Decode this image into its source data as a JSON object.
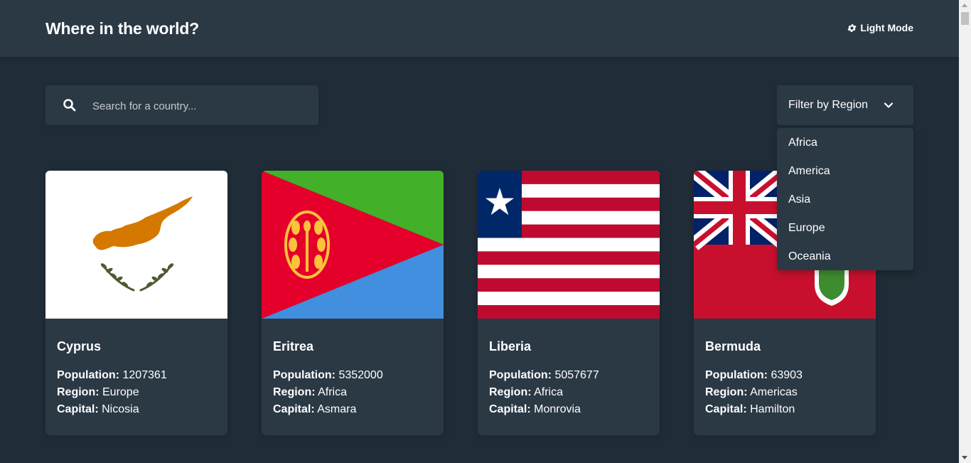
{
  "header": {
    "title": "Where in the world?",
    "mode_toggle_label": "Light Mode",
    "mode_toggle_icon": "gear-icon"
  },
  "search": {
    "placeholder": "Search for a country...",
    "value": "",
    "icon": "search-icon"
  },
  "filter": {
    "label": "Filter by Region",
    "icon": "chevron-down-icon",
    "options": [
      "Africa",
      "America",
      "Asia",
      "Europe",
      "Oceania"
    ]
  },
  "labels": {
    "population": "Population:",
    "region": "Region:",
    "capital": "Capital:"
  },
  "countries": [
    {
      "name": "Cyprus",
      "population": "1207361",
      "region": "Europe",
      "capital": "Nicosia",
      "flag": "cyprus-flag"
    },
    {
      "name": "Eritrea",
      "population": "5352000",
      "region": "Africa",
      "capital": "Asmara",
      "flag": "eritrea-flag"
    },
    {
      "name": "Liberia",
      "population": "5057677",
      "region": "Africa",
      "capital": "Monrovia",
      "flag": "liberia-flag"
    },
    {
      "name": "Bermuda",
      "population": "63903",
      "region": "Americas",
      "capital": "Hamilton",
      "flag": "bermuda-flag"
    }
  ],
  "colors": {
    "background": "#202c37",
    "element": "#2b3945",
    "text": "#ffffff"
  }
}
